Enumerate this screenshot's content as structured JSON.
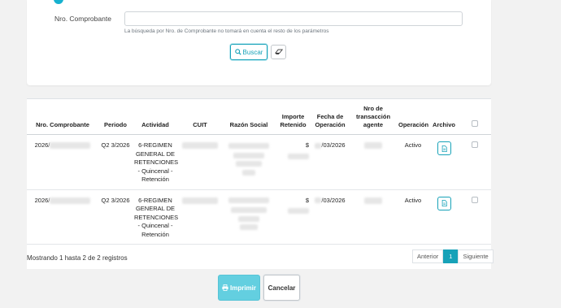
{
  "search": {
    "label": "Nro. Comprobante",
    "value": "",
    "help": "La búsqueda por Nro. de Comprobante no tomará en cuenta el resto de los parámetros",
    "buscar_label": "Buscar"
  },
  "table": {
    "headers": {
      "nro": "Nro. Comprobante",
      "periodo": "Periodo",
      "actividad": "Actividad",
      "cuit": "CUIT",
      "razon": "Razón Social",
      "importe": "Importe Retenido",
      "fecha": "Fecha de Operación",
      "nro_trans": "Nro de transacción agente",
      "operacion": "Operación",
      "archivo": "Archivo"
    },
    "rows": [
      {
        "nro": "2026/",
        "periodo": "Q2 3/2026",
        "actividad": "6-REGIMEN GENERAL DE RETENCIONES - Quincenal - Retención",
        "importe": "$",
        "fecha": "/03/2026",
        "operacion": "Activo"
      },
      {
        "nro": "2026/",
        "periodo": "Q2 3/2026",
        "actividad": "6-REGIMEN GENERAL DE RETENCIONES - Quincenal - Retención",
        "importe": "$",
        "fecha": "/03/2026",
        "operacion": "Activo"
      }
    ]
  },
  "footer": {
    "info": "Mostrando 1 hasta 2 de 2 registros",
    "prev": "Anterior",
    "page": "1",
    "next": "Siguiente"
  },
  "actions": {
    "imprimir": "Imprimir",
    "cancelar": "Cancelar"
  },
  "colors": {
    "accent": "#17a2b8",
    "primary_disabled": "#63cfe0"
  },
  "icons": {
    "buscar": "search-icon",
    "eraser": "eraser-icon",
    "archivo": "file-icon",
    "imprimir": "print-icon"
  }
}
